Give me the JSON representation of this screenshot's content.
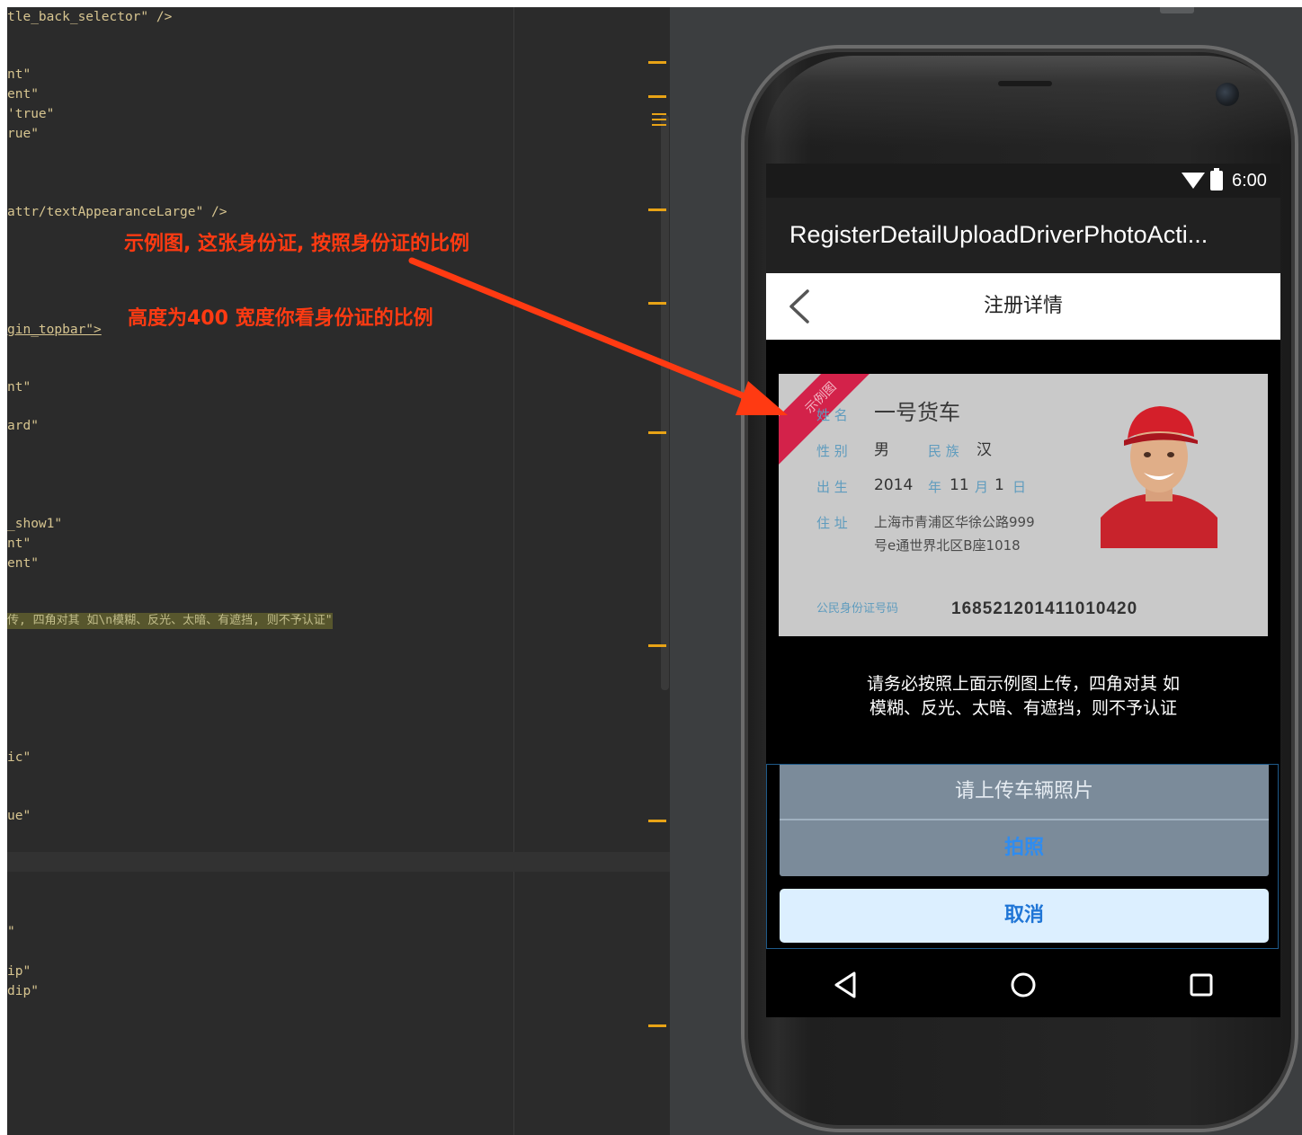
{
  "editor": {
    "lines": [
      {
        "text": "tle_back_selector\" />",
        "kind": "tag"
      },
      {
        "text": "nt\"",
        "kind": "tag"
      },
      {
        "text": "ent\"",
        "kind": "tag"
      },
      {
        "text": "'true\"",
        "kind": "tag"
      },
      {
        "text": "rue\"",
        "kind": "tag"
      },
      {
        "text": "attr/textAppearanceLarge\" />",
        "kind": "tag"
      },
      {
        "text": "gin_topbar\">",
        "kind": "link"
      },
      {
        "text": "nt\"",
        "kind": "tag"
      },
      {
        "text": "ard\"",
        "kind": "tag"
      },
      {
        "text": "_show1\"",
        "kind": "tag"
      },
      {
        "text": "nt\"",
        "kind": "tag"
      },
      {
        "text": "ent\"",
        "kind": "tag"
      },
      {
        "text": "传, 四角对其 如\\n模糊、反光、太暗、有遮挡, 则不予认证\"",
        "kind": "highlight"
      },
      {
        "text": "ic\"",
        "kind": "tag"
      },
      {
        "text": "ue\"",
        "kind": "tag"
      },
      {
        "text": "\"",
        "kind": "tag"
      },
      {
        "text": "ip\"",
        "kind": "tag"
      },
      {
        "text": "dip\"",
        "kind": "tag"
      }
    ],
    "annotations": [
      "示例图, 这张身份证, 按照身份证的比例",
      "高度为400   宽度你看身份证的比例"
    ]
  },
  "phone": {
    "status_time": "6:00",
    "action_bar_title": "RegisterDetailUploadDriverPhotoActi...",
    "topbar_title": "注册详情",
    "id_card": {
      "ribbon": "示例图",
      "name_label": "姓 名",
      "name_value": "一号货车",
      "gender_label": "性 别",
      "gender_value": "男",
      "ethnic_label": "民 族",
      "ethnic_value": "汉",
      "birth_label": "出 生",
      "birth_year": "2014",
      "birth_year_unit": "年",
      "birth_month": "11",
      "birth_month_unit": "月",
      "birth_day": "1",
      "birth_day_unit": "日",
      "address_label": "住 址",
      "address_line1": "上海市青浦区华徐公路999",
      "address_line2": "号e通世界北区B座1018",
      "id_number_label": "公民身份证号码",
      "id_number": "168521201411010420"
    },
    "tip_line1": "请务必按照上面示例图上传，四角对其 如",
    "tip_line2": "模糊、反光、太暗、有遮挡，则不予认证",
    "sheet": {
      "title": "请上传车辆照片",
      "take_photo": "拍照",
      "cancel": "取消"
    },
    "colors": {
      "annotation_red": "#ff3a12",
      "ribbon": "#d3224a",
      "sheet_bg": "#7b8b9a",
      "cancel_bg": "#dcefff",
      "link_blue": "#2f8cf0"
    },
    "icons": [
      "wifi-icon",
      "battery-icon",
      "back-chevron-icon",
      "nav-back-icon",
      "nav-home-icon",
      "nav-recents-icon"
    ]
  }
}
